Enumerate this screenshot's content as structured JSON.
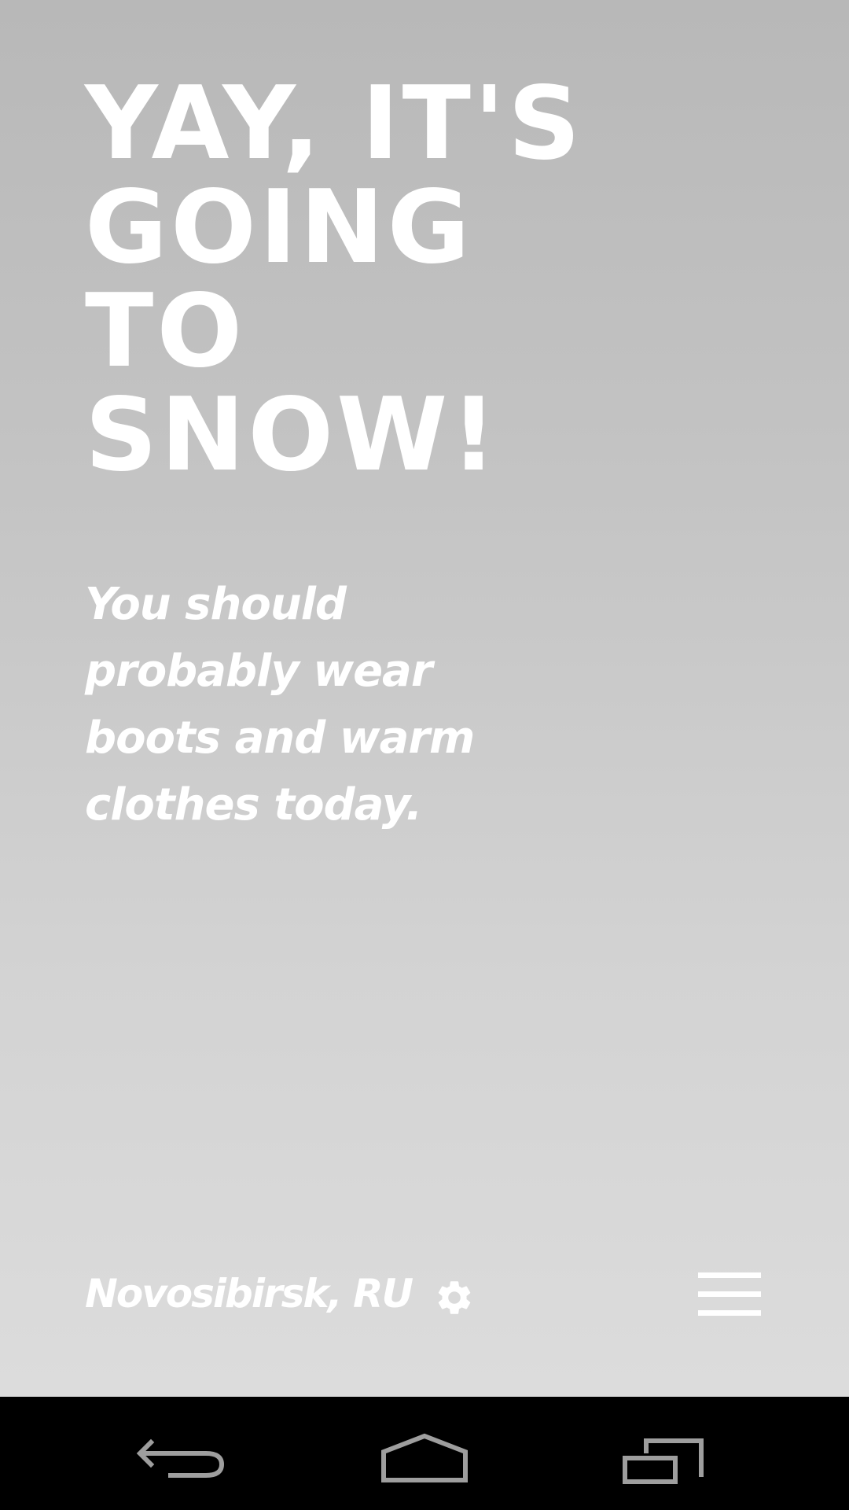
{
  "main": {
    "headline": "YAY, IT'S\nGOING\nTO\nSNOW!",
    "subtext": "You should probably wear boots and warm clothes today."
  },
  "footer": {
    "location": "Novosibirsk, RU",
    "settings_icon": "gear-icon",
    "menu_icon": "hamburger-menu-icon"
  },
  "navbar": {
    "back_icon": "back-icon",
    "home_icon": "home-icon",
    "recents_icon": "recents-icon"
  },
  "colors": {
    "background_top": "#b8b8b8",
    "background_bottom": "#dcdcdc",
    "text": "#ffffff",
    "navbar": "#000000",
    "nav_icons": "#9e9e9e"
  }
}
